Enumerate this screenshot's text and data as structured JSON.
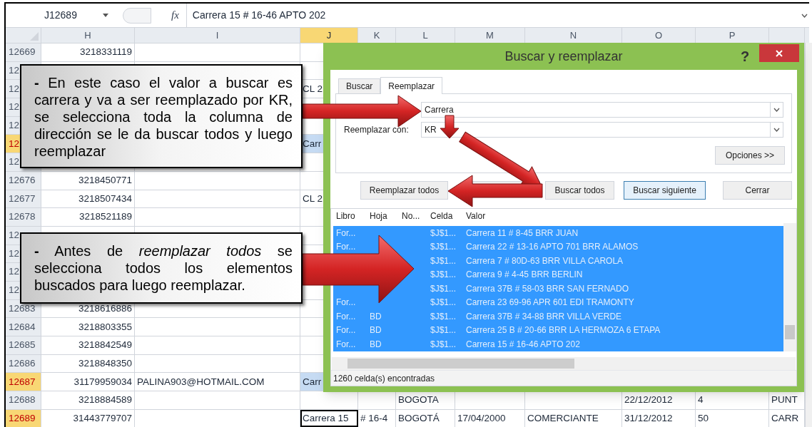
{
  "formula_bar": {
    "name_box": "J12689",
    "fx": "fx",
    "formula": "Carrera 15 # 16-46 APTO 202"
  },
  "sheet": {
    "columns": [
      {
        "label": "H",
        "selected": false
      },
      {
        "label": "I",
        "selected": false
      },
      {
        "label": "J",
        "selected": true
      },
      {
        "label": "K",
        "selected": false
      },
      {
        "label": "L",
        "selected": false
      },
      {
        "label": "M",
        "selected": false
      },
      {
        "label": "N",
        "selected": false
      },
      {
        "label": "O",
        "selected": false
      },
      {
        "label": "P",
        "selected": false
      }
    ],
    "rows": [
      {
        "number": "12669",
        "selected": false,
        "cells": [
          {
            "text": "3218331119",
            "kind": "plain"
          }
        ]
      },
      {
        "number": "12",
        "selected": false,
        "cells": []
      },
      {
        "number": "12",
        "selected": false,
        "cells": [
          null,
          null,
          {
            "text": "CL 2",
            "kind": "plain"
          }
        ]
      },
      {
        "number": "12",
        "selected": false,
        "cells": []
      },
      {
        "number": "12",
        "selected": false,
        "cells": []
      },
      {
        "number": "12",
        "selected": true,
        "cells": [
          null,
          null,
          {
            "text": "Carr",
            "kind": "found"
          }
        ]
      },
      {
        "number": "12",
        "selected": false,
        "cells": []
      },
      {
        "number": "12676",
        "selected": false,
        "cells": [
          {
            "text": "3218450771",
            "kind": "plain"
          }
        ]
      },
      {
        "number": "12677",
        "selected": false,
        "cells": [
          {
            "text": "3218507434",
            "kind": "plain"
          },
          null,
          {
            "text": "CL 2",
            "kind": "plain"
          }
        ]
      },
      {
        "number": "12678",
        "selected": false,
        "cells": [
          {
            "text": "3218521189",
            "kind": "plain"
          }
        ]
      },
      {
        "number": "12",
        "selected": false,
        "cells": []
      },
      {
        "number": "12",
        "selected": false,
        "cells": []
      },
      {
        "number": "12",
        "selected": false,
        "cells": []
      },
      {
        "number": "12",
        "selected": false,
        "cells": []
      },
      {
        "number": "12683",
        "selected": false,
        "cells": [
          {
            "text": "3218616886",
            "kind": "plain"
          }
        ]
      },
      {
        "number": "12684",
        "selected": false,
        "cells": [
          {
            "text": "3218803355",
            "kind": "plain"
          }
        ]
      },
      {
        "number": "12685",
        "selected": false,
        "cells": [
          {
            "text": "3218842549",
            "kind": "plain"
          }
        ]
      },
      {
        "number": "12686",
        "selected": false,
        "cells": [
          {
            "text": "3218848350",
            "kind": "plain"
          }
        ]
      },
      {
        "number": "12687",
        "selected": true,
        "cells": [
          {
            "text": "31179959034",
            "kind": "plain"
          },
          {
            "text": "PALINA903@HOTMAIL.COM",
            "kind": "plain"
          },
          {
            "text": "Carr",
            "kind": "found"
          }
        ]
      },
      {
        "number": "12688",
        "selected": false,
        "cells": [
          {
            "text": "3218884589",
            "kind": "plain"
          },
          null,
          null,
          null,
          {
            "text": "BOGOTA",
            "kind": "plain"
          },
          null,
          null,
          {
            "text": "22/12/2012",
            "kind": "plain"
          },
          {
            "text": "4",
            "kind": "plain"
          },
          {
            "text": "PUNT",
            "kind": "plain"
          }
        ]
      },
      {
        "number": "12689",
        "selected": true,
        "cells": [
          {
            "text": "31443779707",
            "kind": "plain"
          },
          null,
          {
            "text": "Carrera 15",
            "kind": "active"
          },
          {
            "text": "# 16-4",
            "kind": "plain"
          },
          {
            "text": "BOGOTÁ",
            "kind": "plain"
          },
          {
            "text": "17/04/2000",
            "kind": "plain"
          },
          {
            "text": "COMERCIANTE",
            "kind": "plain"
          },
          {
            "text": "31/12/2012",
            "kind": "plain"
          },
          {
            "text": "50",
            "kind": "plain"
          },
          {
            "text": "CARR",
            "kind": "plain"
          }
        ]
      }
    ]
  },
  "dialog": {
    "title": "Buscar y reemplazar",
    "help": "?",
    "tabs": [
      {
        "label": "Buscar",
        "selected": false
      },
      {
        "label": "Reemplazar",
        "selected": true
      }
    ],
    "find_value": "Carrera",
    "replace_label": "Reemplazar con:",
    "replace_value": "KR",
    "options_button": "Opciones >>",
    "buttons": [
      {
        "label": "Reemplazar todos",
        "focused": false
      },
      {
        "label": "Buscar todos",
        "focused": false
      },
      {
        "label": "Buscar siguiente",
        "focused": true
      },
      {
        "label": "Cerrar",
        "focused": false
      }
    ],
    "results": {
      "columns": [
        "Libro",
        "Hoja",
        "No...",
        "Celda",
        "Valor"
      ],
      "rows": [
        {
          "libro": "For...",
          "celda": "$J$1...",
          "valor": "Carrera 11 # 8-45 BRR JUAN",
          "selected": true
        },
        {
          "libro": "For...",
          "celda": "$J$1...",
          "valor": "Carrera 22 # 13-16 APTO 701 BRR ALAMOS",
          "selected": true
        },
        {
          "celda": "$J$1...",
          "valor": "Carrera 7 # 80D-63 BRR VILLA CAROLA",
          "selected": true
        },
        {
          "celda": "$J$1...",
          "valor": "Carrera 9 # 4-45 BRR BERLIN",
          "selected": true
        },
        {
          "celda": "$J$1...",
          "valor": "Carrera 37B # 58-03 BRR SAN FERNADO",
          "selected": true
        },
        {
          "libro": "For...",
          "celda": "$J$1...",
          "valor": "Carrera 23 69-96 APR 601 EDI TRAMONTY",
          "selected": true
        },
        {
          "libro": "For...",
          "hoja": "BD",
          "celda": "$J$1...",
          "valor": "Carrera 37B # 34-88 BRR VILLA VERDE",
          "selected": true
        },
        {
          "libro": "For...",
          "hoja": "BD",
          "celda": "$J$1...",
          "valor": "Carrera 25 B # 20-66 BRR LA HERMOZA 6 ETAPA",
          "selected": true
        },
        {
          "libro": "For...",
          "hoja": "BD",
          "celda": "$J$1...",
          "valor": "Carrera 15 # 16-46 APTO 202",
          "selected": true
        }
      ]
    },
    "status": "1260 celda(s) encontradas"
  },
  "callouts": [
    {
      "text": "**-** En este caso el valor a buscar es carrera y va a ser reemplazado por KR, se selecciona toda la columna de dirección se le da buscar todos y luego reemplazar"
    },
    {
      "text": "**-** Antes de *reemplazar todos* se selecciona todos los elementos buscados para luego reemplazar."
    }
  ]
}
